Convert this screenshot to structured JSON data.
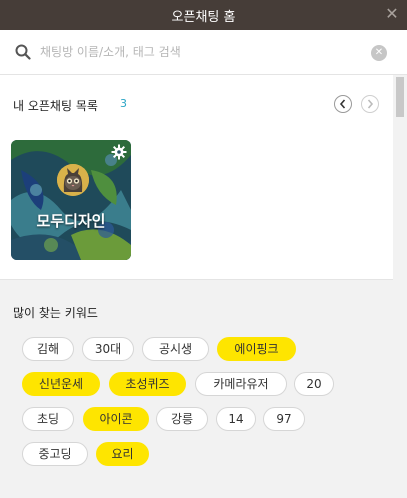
{
  "window": {
    "title": "오픈채팅 홈"
  },
  "search": {
    "placeholder": "채팅방 이름/소개, 태그 검색",
    "value": ""
  },
  "my_list": {
    "label": "내 오픈채팅 목록",
    "count": "3",
    "rooms": [
      {
        "name": "모두디자인"
      }
    ]
  },
  "keywords": {
    "label": "많이 찾는 키워드",
    "rows": [
      [
        {
          "text": "김해",
          "hl": false
        },
        {
          "text": "30대",
          "hl": false
        },
        {
          "text": "공시생",
          "hl": false
        },
        {
          "text": "에이핑크",
          "hl": true
        }
      ],
      [
        {
          "text": "신년운세",
          "hl": true
        },
        {
          "text": "초성퀴즈",
          "hl": true
        },
        {
          "text": "카메라유저",
          "hl": false
        },
        {
          "text": "20",
          "hl": false
        }
      ],
      [
        {
          "text": "초딩",
          "hl": false
        },
        {
          "text": "아이콘",
          "hl": true
        },
        {
          "text": "강릉",
          "hl": false
        },
        {
          "text": "14",
          "hl": false
        },
        {
          "text": "97",
          "hl": false
        }
      ],
      [
        {
          "text": "중고딩",
          "hl": false
        },
        {
          "text": "요리",
          "hl": true
        }
      ]
    ]
  },
  "colors": {
    "titlebar": "#463d38",
    "highlight": "#fee500",
    "count": "#2ba5c5"
  }
}
